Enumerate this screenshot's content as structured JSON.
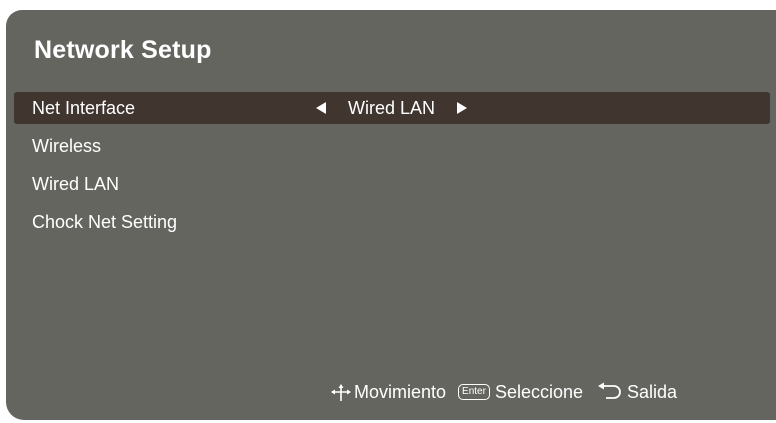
{
  "title": "Network Setup",
  "menu": {
    "items": [
      {
        "label": "Net Interface",
        "value": "Wired LAN",
        "selected": true
      },
      {
        "label": "Wireless"
      },
      {
        "label": "Wired LAN"
      },
      {
        "label": "Chock Net Setting"
      }
    ]
  },
  "help": {
    "move_icon": "move-arrows-icon",
    "move_label": "Movimiento",
    "enter_key_label": "Enter",
    "select_label": "Seleccione",
    "return_icon": "return-arrow-icon",
    "exit_label": "Salida"
  },
  "colors": {
    "panel_background": "#656560",
    "selected_row": "#40352f",
    "text": "#ffffff"
  }
}
